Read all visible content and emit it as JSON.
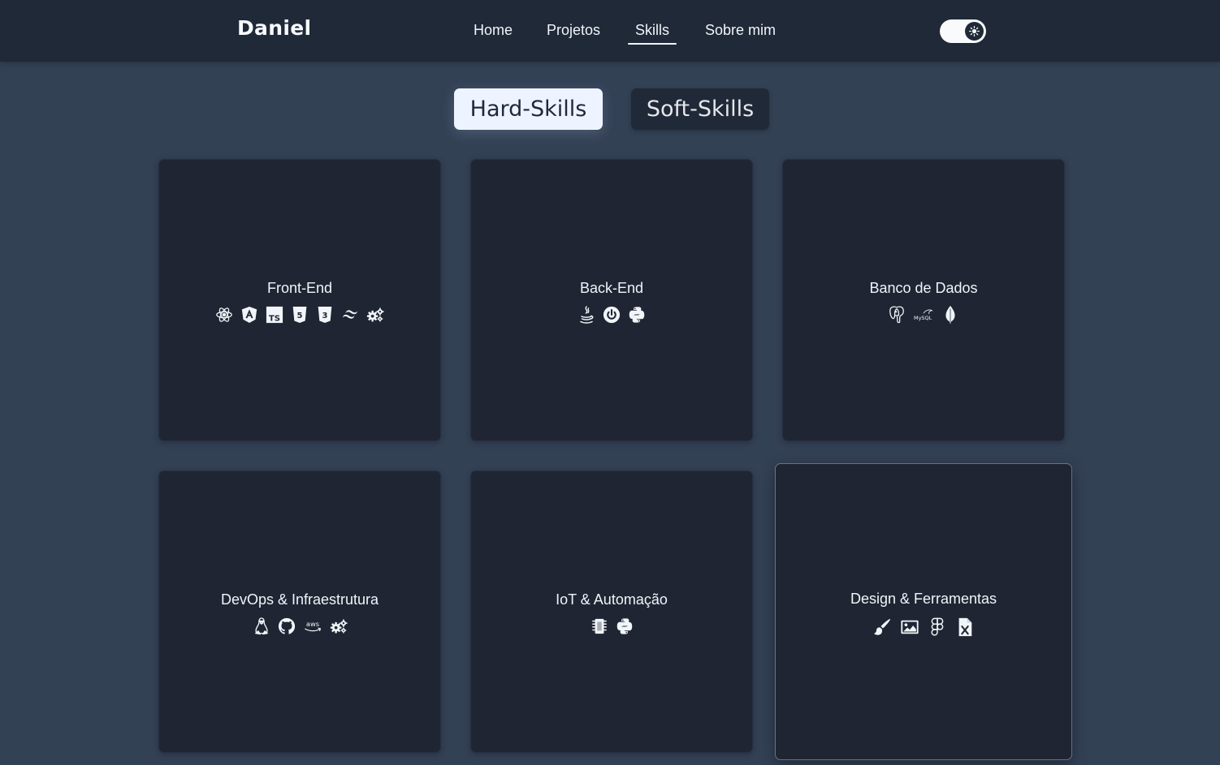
{
  "navbar": {
    "brand": "Daniel",
    "links": [
      "Home",
      "Projetos",
      "Skills",
      "Sobre mim"
    ],
    "active_link": "Skills",
    "theme_toggle_icon": "sun-icon"
  },
  "tabs": {
    "hard": "Hard-Skills",
    "soft": "Soft-Skills",
    "active": "Hard-Skills"
  },
  "cards": [
    {
      "title": "Front-End",
      "icons": [
        "react-icon",
        "angular-icon",
        "typescript-icon",
        "html5-icon",
        "css3-icon",
        "tailwind-icon",
        "cogs-icon"
      ]
    },
    {
      "title": "Back-End",
      "icons": [
        "java-icon",
        "spring-icon",
        "python-icon"
      ]
    },
    {
      "title": "Banco de Dados",
      "icons": [
        "postgresql-icon",
        "mysql-icon",
        "mongodb-icon"
      ],
      "icon_text": {
        "mysql": "MySQL"
      }
    },
    {
      "title": "DevOps & Infraestrutura",
      "icons": [
        "linux-icon",
        "github-icon",
        "aws-icon",
        "cogs-icon"
      ],
      "icon_text": {
        "aws": "aws"
      }
    },
    {
      "title": "IoT & Automação",
      "icons": [
        "microchip-icon",
        "python-icon"
      ]
    },
    {
      "title": "Design & Ferramentas",
      "icons": [
        "paint-brush-icon",
        "image-icon",
        "figma-icon",
        "excel-icon"
      ]
    }
  ],
  "colors": {
    "page_bg": "#334155",
    "navbar_bg": "#1f2937",
    "card_bg": "#1f2533",
    "active_tab_bg": "#eef4ff"
  }
}
